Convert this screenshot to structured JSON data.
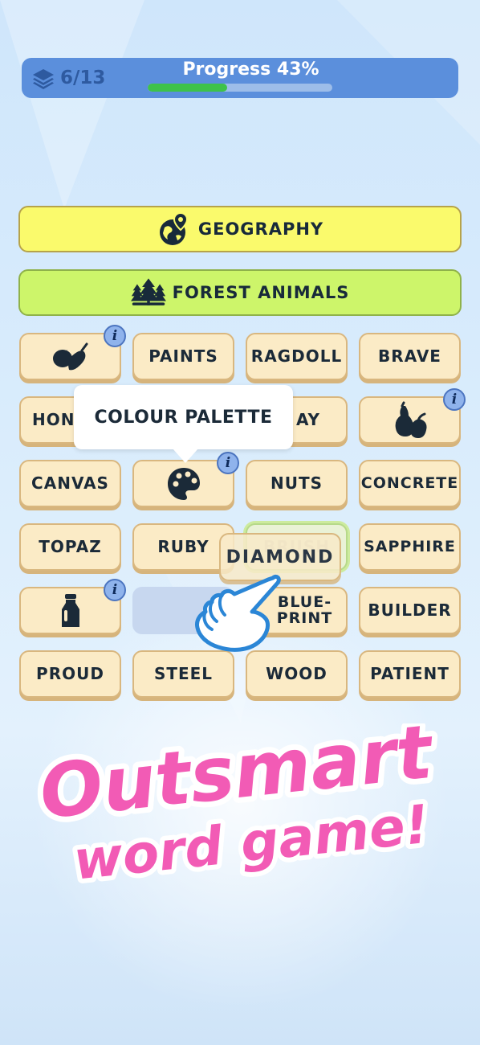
{
  "header": {
    "level": "6/13",
    "progress_label": "Progress 43%",
    "progress_value": 0.43
  },
  "categories": [
    {
      "name": "GEOGRAPHY",
      "icon": "globe-pin-icon",
      "color": "#fafa6c"
    },
    {
      "name": "FOREST ANIMALS",
      "icon": "pine-trees-icon",
      "color": "#cdf56a"
    }
  ],
  "tiles": {
    "r1": [
      "vegetables-icon",
      "PAINTS",
      "RAGDOLL",
      "BRAVE"
    ],
    "r2": [
      "HON",
      "AY",
      "fruit-icon"
    ],
    "r3": [
      "CANVAS",
      "palette-icon",
      "NUTS",
      "CONCRETE"
    ],
    "r4": [
      "TOPAZ",
      "RUBY",
      "BRUSH",
      "SAPPHIRE"
    ],
    "r5": [
      "milk-bottle-icon",
      "",
      "BLUE-PRINT",
      "BUILDER"
    ],
    "r6": [
      "PROUD",
      "STEEL",
      "WOOD",
      "PATIENT"
    ]
  },
  "labels": {
    "paints": "PAINTS",
    "ragdoll": "RAGDOLL",
    "brave": "BRAVE",
    "hon": "HON",
    "ay": "AY",
    "canvas": "CANVAS",
    "nuts": "NUTS",
    "concrete": "CONCRETE",
    "topaz": "TOPAZ",
    "ruby": "RUBY",
    "brush": "BRUSH",
    "sapphire": "SAPPHIRE",
    "blueprint_1": "BLUE-",
    "blueprint_2": "PRINT",
    "builder": "BUILDER",
    "proud": "PROUD",
    "steel": "STEEL",
    "wood": "WOOD",
    "patient": "PATIENT"
  },
  "tooltip": "COLOUR PALETTE",
  "dragging": "DIAMOND",
  "info_glyph": "i",
  "slogan": {
    "line1": "Outsmart",
    "line2": "word game!"
  },
  "colors": {
    "accent_pink": "#f25bb5",
    "progress_green": "#3ec24a",
    "topbar": "#5b8fdc"
  }
}
